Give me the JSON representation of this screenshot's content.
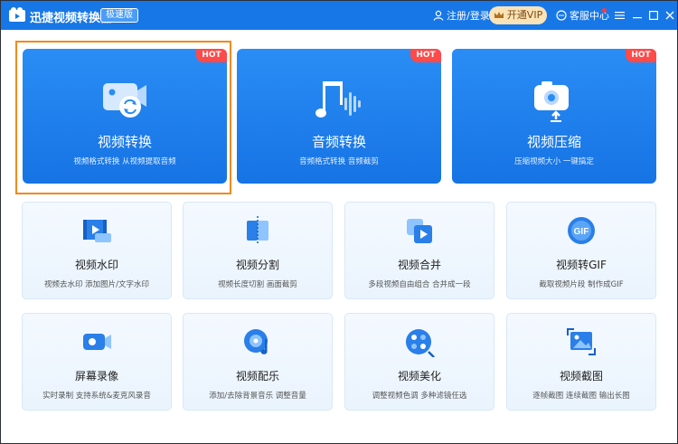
{
  "titlebar": {
    "app_title": "迅捷视频转换器",
    "edition_badge": "极速版",
    "login_label": "注册/登录",
    "vip_label": "开通VIP",
    "service_label": "客服中心",
    "icons": [
      "app-logo-icon",
      "user-icon",
      "crown-icon",
      "chat-icon",
      "menu-icon",
      "minimize-icon",
      "maximize-icon",
      "close-icon"
    ]
  },
  "colors": {
    "titlebar": "#1877e6",
    "card_blue": "#1b7cec",
    "hot_badge": "#ff4a4a",
    "selection_frame": "#f08a1c",
    "vip_bg": "#fbe3b8",
    "small_card_bg": "#eef6fe"
  },
  "big_cards": [
    {
      "title": "视频转换",
      "desc": "视频格式转换 从视频提取音频",
      "badge": "HOT",
      "icon": "video-convert-icon"
    },
    {
      "title": "音频转换",
      "desc": "音频格式转换 音频截剪",
      "badge": "HOT",
      "icon": "audio-convert-icon"
    },
    {
      "title": "视频压缩",
      "desc": "压缩视频大小 一键搞定",
      "badge": "HOT",
      "icon": "video-compress-icon"
    }
  ],
  "small_cards": [
    {
      "title": "视频水印",
      "desc": "视频去水印 添加图片/文字水印",
      "icon": "watermark-icon"
    },
    {
      "title": "视频分割",
      "desc": "视频长度切割 画面截剪",
      "icon": "split-icon"
    },
    {
      "title": "视频合并",
      "desc": "多段视频自由组合 合并成一段",
      "icon": "merge-icon"
    },
    {
      "title": "视频转GIF",
      "desc": "截取视频片段 制作成GIF",
      "icon": "gif-icon",
      "icon_text": "GIF"
    },
    {
      "title": "屏幕录像",
      "desc": "实时录制 支持系统&麦克风录音",
      "icon": "screen-record-icon"
    },
    {
      "title": "视频配乐",
      "desc": "添加/去除背景音乐 调整音量",
      "icon": "music-icon"
    },
    {
      "title": "视频美化",
      "desc": "调整视频色调 多种滤镜任选",
      "icon": "beautify-icon"
    },
    {
      "title": "视频截图",
      "desc": "逐帧截图 连续截图 输出长图",
      "icon": "screenshot-icon"
    }
  ]
}
